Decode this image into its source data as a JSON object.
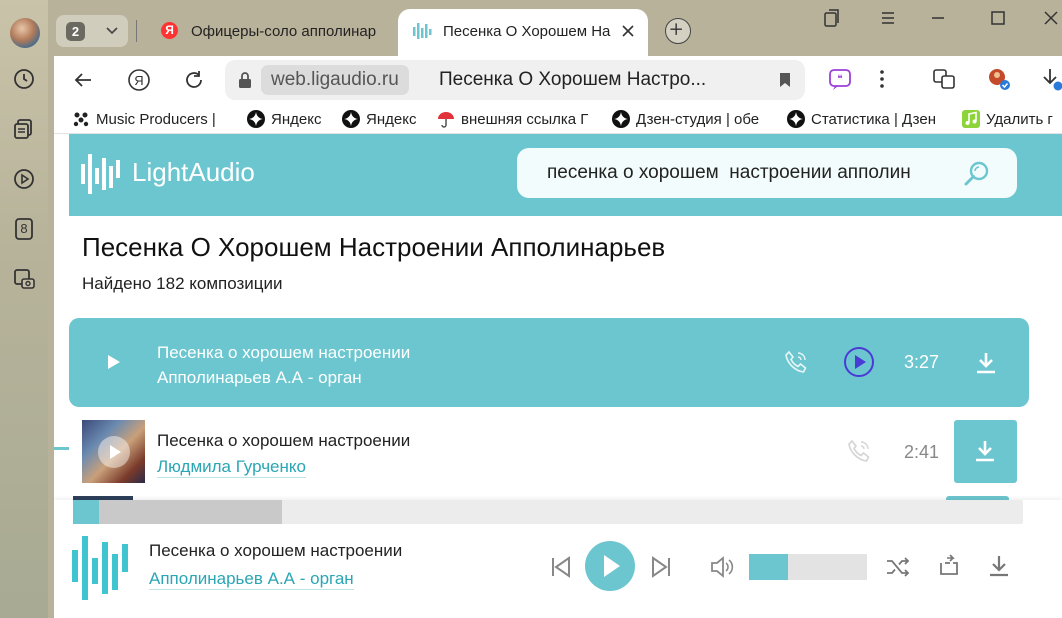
{
  "browser": {
    "tab_count": "2",
    "tabs": [
      {
        "title": "Офицеры-соло апполинар"
      },
      {
        "title": "Песенка О Хорошем На"
      }
    ],
    "address": {
      "domain": "web.ligaudio.ru",
      "page_title": "Песенка О Хорошем Настро..."
    },
    "bookmarks": [
      {
        "label": "Music Producers |"
      },
      {
        "label": "Яндекс"
      },
      {
        "label": "Яндекс"
      },
      {
        "label": "внешняя ссылка Г"
      },
      {
        "label": "Дзен-студия | обе"
      },
      {
        "label": "Статистика | Дзен"
      },
      {
        "label": "Удалить г"
      }
    ],
    "left_panel": {
      "badge": "8"
    }
  },
  "site": {
    "logo_text": "LightAudio",
    "search": {
      "value": "песенка о хорошем  настроении апполин"
    },
    "heading": "Песенка О Хорошем Настроении Апполинарьев",
    "found": "Найдено 182 композиции",
    "tracks": [
      {
        "title": "Песенка о хорошем настроении",
        "artist": "Апполинарьев А.А - орган",
        "duration": "3:27"
      },
      {
        "title": "Песенка о хорошем настроении",
        "artist": "Людмила Гурченко",
        "duration": "2:41"
      }
    ]
  },
  "player": {
    "title": "Песенка о хорошем настроении",
    "artist": "Апполинарьев А.А - орган",
    "progress_fraction": 0.027,
    "buffered_fraction": 0.22,
    "volume_fraction": 0.33
  },
  "colors": {
    "accent": "#6cc6cf",
    "link": "#2aa6b4",
    "play_ring": "#4a3bd6"
  }
}
